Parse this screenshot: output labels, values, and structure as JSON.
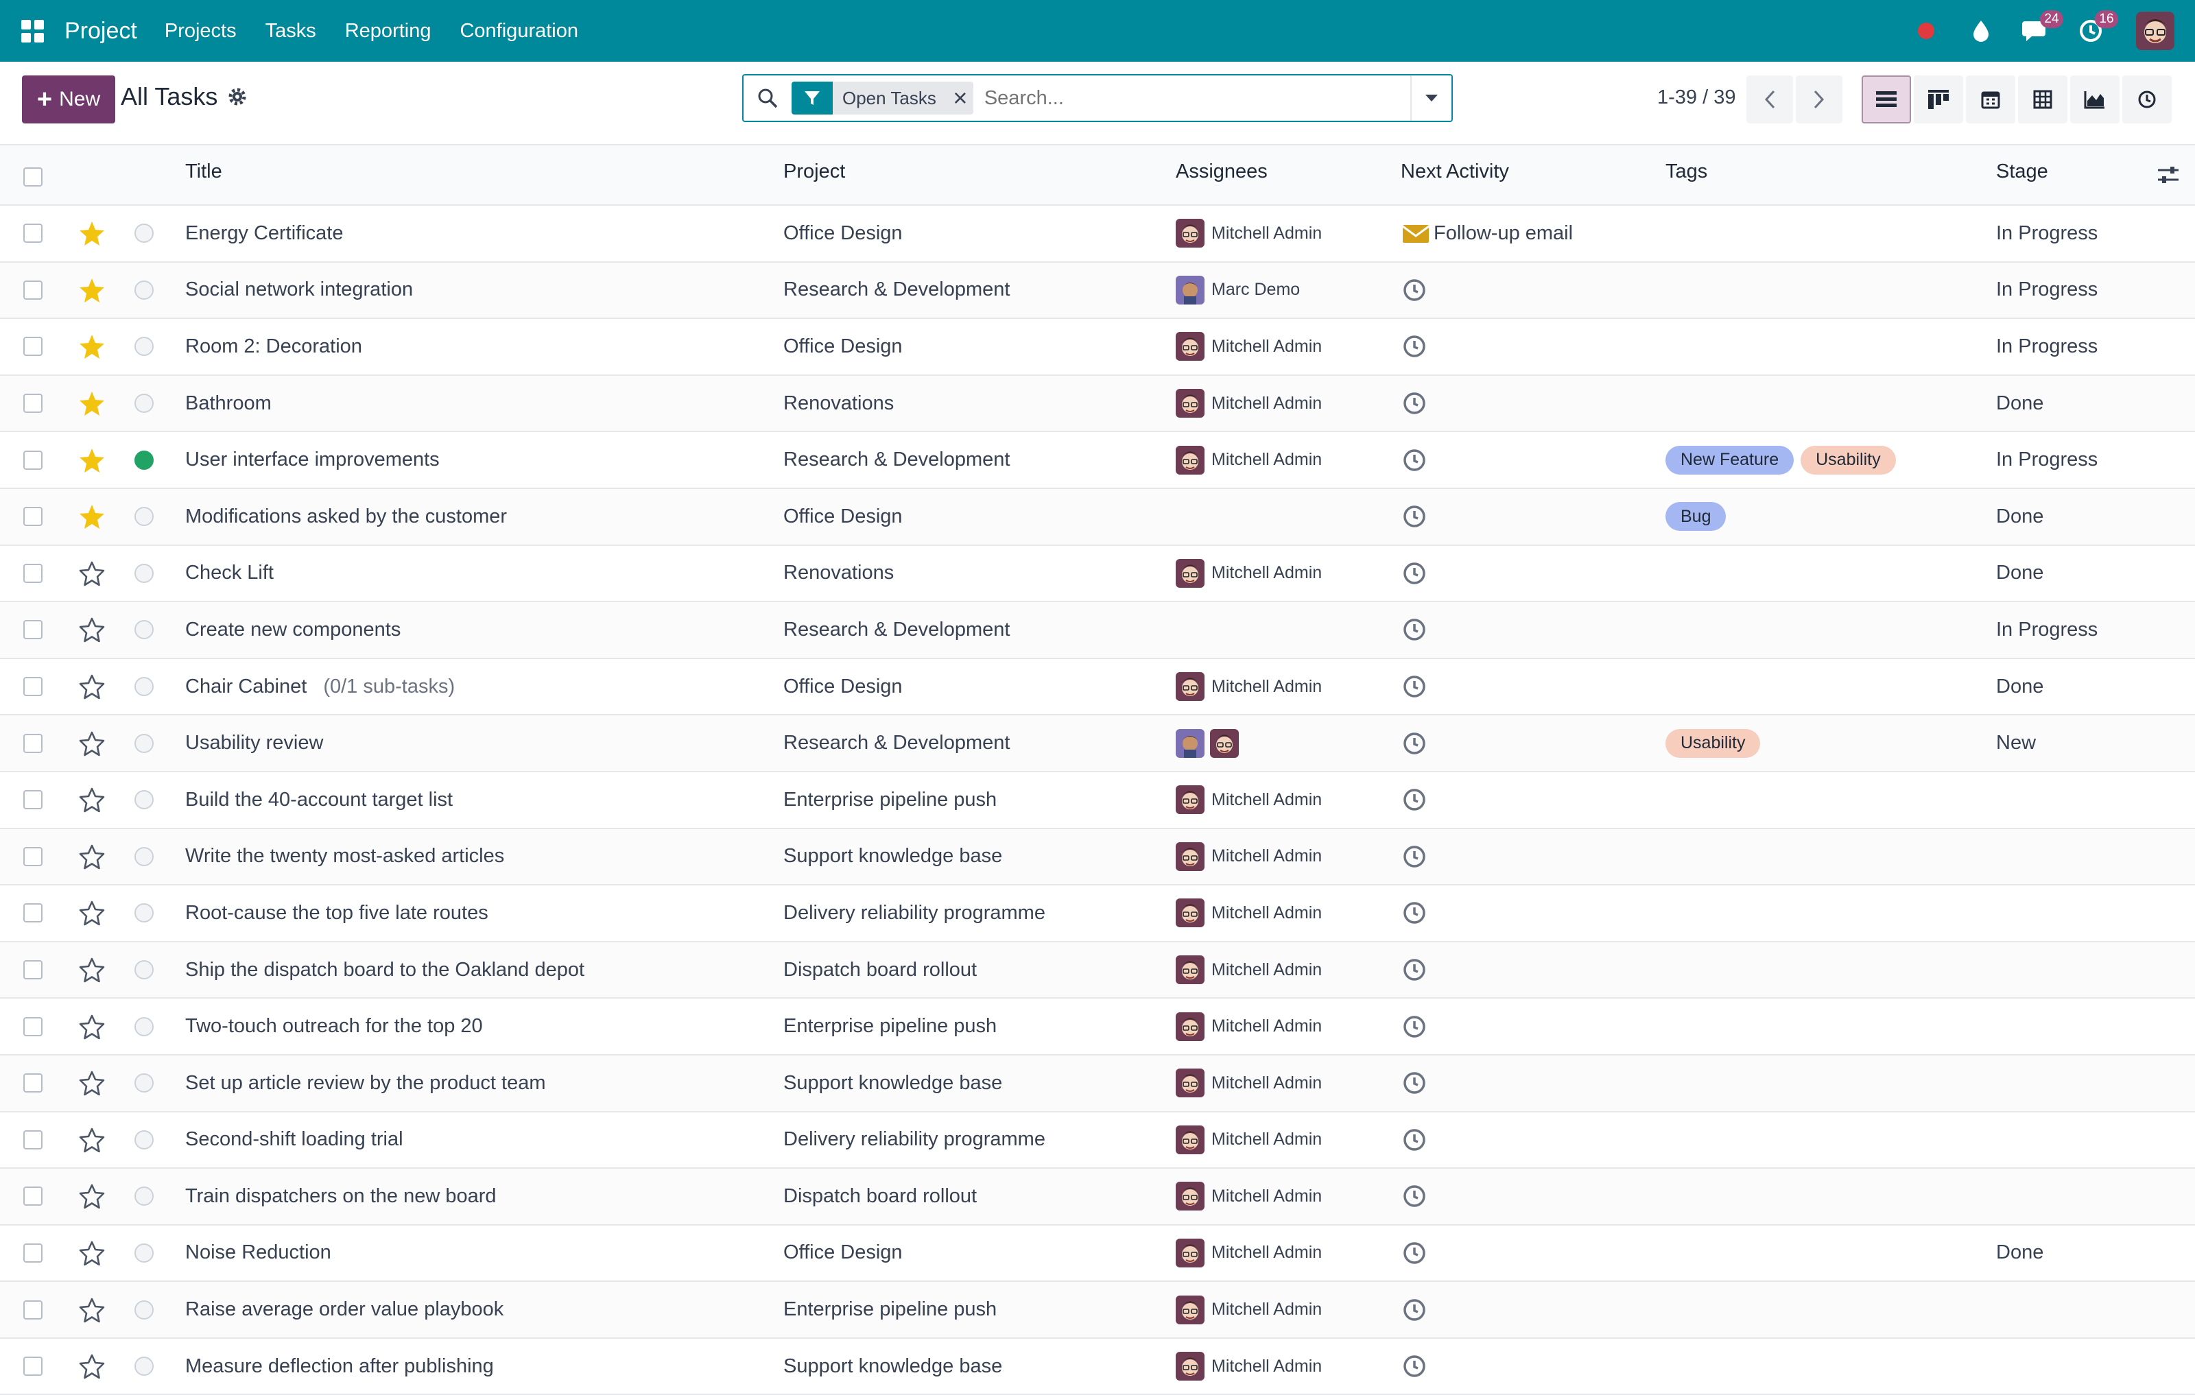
{
  "navbar": {
    "app_name": "Project",
    "menu": [
      "Projects",
      "Tasks",
      "Reporting",
      "Configuration"
    ],
    "messages_count": "24",
    "activities_count": "16",
    "color_brand": "#00889b",
    "icons": [
      "apps-grid-icon",
      "recording-dot-icon",
      "droplet-icon",
      "chat-icon",
      "clock-icon",
      "user-avatar"
    ]
  },
  "control_panel": {
    "new_label": "New",
    "breadcrumb": "All Tasks",
    "search": {
      "facet": "Open Tasks",
      "placeholder": "Search..."
    },
    "pager": "1-39 / 39",
    "views": [
      "list-view-icon",
      "kanban-view-icon",
      "calendar-view-icon",
      "pivot-view-icon",
      "graph-view-icon",
      "activity-view-icon"
    ],
    "active_view": "list"
  },
  "list": {
    "columns": [
      "Title",
      "Project",
      "Assignees",
      "Next Activity",
      "Tags",
      "Stage"
    ],
    "rows": [
      {
        "starred": true,
        "kanban_done": false,
        "title": "Energy Certificate",
        "subtasks": "",
        "project": "Office Design",
        "assignees": [
          {
            "name": "Mitchell Admin",
            "avatar": "mitchell"
          }
        ],
        "activity": "Follow-up email",
        "activity_icon": "envelope",
        "tags": [],
        "stage": "In Progress"
      },
      {
        "starred": true,
        "kanban_done": false,
        "title": "Social network integration",
        "subtasks": "",
        "project": "Research & Development",
        "assignees": [
          {
            "name": "Marc Demo",
            "avatar": "marc"
          }
        ],
        "activity": "",
        "activity_icon": "clock",
        "tags": [],
        "stage": "In Progress"
      },
      {
        "starred": true,
        "kanban_done": false,
        "title": "Room 2: Decoration",
        "subtasks": "",
        "project": "Office Design",
        "assignees": [
          {
            "name": "Mitchell Admin",
            "avatar": "mitchell"
          }
        ],
        "activity": "",
        "activity_icon": "clock",
        "tags": [],
        "stage": "In Progress"
      },
      {
        "starred": true,
        "kanban_done": false,
        "title": "Bathroom",
        "subtasks": "",
        "project": "Renovations",
        "assignees": [
          {
            "name": "Mitchell Admin",
            "avatar": "mitchell"
          }
        ],
        "activity": "",
        "activity_icon": "clock",
        "tags": [],
        "stage": "Done"
      },
      {
        "starred": true,
        "kanban_done": true,
        "title": "User interface improvements",
        "subtasks": "",
        "project": "Research & Development",
        "assignees": [
          {
            "name": "Mitchell Admin",
            "avatar": "mitchell"
          }
        ],
        "activity": "",
        "activity_icon": "clock",
        "tags": [
          {
            "label": "New Feature",
            "color": "blue"
          },
          {
            "label": "Usability",
            "color": "peach"
          }
        ],
        "stage": "In Progress"
      },
      {
        "starred": true,
        "kanban_done": false,
        "title": "Modifications asked by the customer",
        "subtasks": "",
        "project": "Office Design",
        "assignees": [],
        "activity": "",
        "activity_icon": "clock",
        "tags": [
          {
            "label": "Bug",
            "color": "blue"
          }
        ],
        "stage": "Done"
      },
      {
        "starred": false,
        "kanban_done": false,
        "title": "Check Lift",
        "subtasks": "",
        "project": "Renovations",
        "assignees": [
          {
            "name": "Mitchell Admin",
            "avatar": "mitchell"
          }
        ],
        "activity": "",
        "activity_icon": "clock",
        "tags": [],
        "stage": "Done"
      },
      {
        "starred": false,
        "kanban_done": false,
        "title": "Create new components",
        "subtasks": "",
        "project": "Research & Development",
        "assignees": [],
        "activity": "",
        "activity_icon": "clock",
        "tags": [],
        "stage": "In Progress"
      },
      {
        "starred": false,
        "kanban_done": false,
        "title": "Chair Cabinet",
        "subtasks": "(0/1 sub-tasks)",
        "project": "Office Design",
        "assignees": [
          {
            "name": "Mitchell Admin",
            "avatar": "mitchell"
          }
        ],
        "activity": "",
        "activity_icon": "clock",
        "tags": [],
        "stage": "Done"
      },
      {
        "starred": false,
        "kanban_done": false,
        "title": "Usability review",
        "subtasks": "",
        "project": "Research & Development",
        "assignees": [
          {
            "name": "",
            "avatar": "marc"
          },
          {
            "name": "",
            "avatar": "mitchell"
          }
        ],
        "activity": "",
        "activity_icon": "clock",
        "tags": [
          {
            "label": "Usability",
            "color": "peach"
          }
        ],
        "stage": "New"
      },
      {
        "starred": false,
        "kanban_done": false,
        "title": "Build the 40-account target list",
        "subtasks": "",
        "project": "Enterprise pipeline push",
        "assignees": [
          {
            "name": "Mitchell Admin",
            "avatar": "mitchell"
          }
        ],
        "activity": "",
        "activity_icon": "clock",
        "tags": [],
        "stage": ""
      },
      {
        "starred": false,
        "kanban_done": false,
        "title": "Write the twenty most-asked articles",
        "subtasks": "",
        "project": "Support knowledge base",
        "assignees": [
          {
            "name": "Mitchell Admin",
            "avatar": "mitchell"
          }
        ],
        "activity": "",
        "activity_icon": "clock",
        "tags": [],
        "stage": ""
      },
      {
        "starred": false,
        "kanban_done": false,
        "title": "Root-cause the top five late routes",
        "subtasks": "",
        "project": "Delivery reliability programme",
        "assignees": [
          {
            "name": "Mitchell Admin",
            "avatar": "mitchell"
          }
        ],
        "activity": "",
        "activity_icon": "clock",
        "tags": [],
        "stage": ""
      },
      {
        "starred": false,
        "kanban_done": false,
        "title": "Ship the dispatch board to the Oakland depot",
        "subtasks": "",
        "project": "Dispatch board rollout",
        "assignees": [
          {
            "name": "Mitchell Admin",
            "avatar": "mitchell"
          }
        ],
        "activity": "",
        "activity_icon": "clock",
        "tags": [],
        "stage": ""
      },
      {
        "starred": false,
        "kanban_done": false,
        "title": "Two-touch outreach for the top 20",
        "subtasks": "",
        "project": "Enterprise pipeline push",
        "assignees": [
          {
            "name": "Mitchell Admin",
            "avatar": "mitchell"
          }
        ],
        "activity": "",
        "activity_icon": "clock",
        "tags": [],
        "stage": ""
      },
      {
        "starred": false,
        "kanban_done": false,
        "title": "Set up article review by the product team",
        "subtasks": "",
        "project": "Support knowledge base",
        "assignees": [
          {
            "name": "Mitchell Admin",
            "avatar": "mitchell"
          }
        ],
        "activity": "",
        "activity_icon": "clock",
        "tags": [],
        "stage": ""
      },
      {
        "starred": false,
        "kanban_done": false,
        "title": "Second-shift loading trial",
        "subtasks": "",
        "project": "Delivery reliability programme",
        "assignees": [
          {
            "name": "Mitchell Admin",
            "avatar": "mitchell"
          }
        ],
        "activity": "",
        "activity_icon": "clock",
        "tags": [],
        "stage": ""
      },
      {
        "starred": false,
        "kanban_done": false,
        "title": "Train dispatchers on the new board",
        "subtasks": "",
        "project": "Dispatch board rollout",
        "assignees": [
          {
            "name": "Mitchell Admin",
            "avatar": "mitchell"
          }
        ],
        "activity": "",
        "activity_icon": "clock",
        "tags": [],
        "stage": ""
      },
      {
        "starred": false,
        "kanban_done": false,
        "title": "Noise Reduction",
        "subtasks": "",
        "project": "Office Design",
        "assignees": [
          {
            "name": "Mitchell Admin",
            "avatar": "mitchell"
          }
        ],
        "activity": "",
        "activity_icon": "clock",
        "tags": [],
        "stage": "Done"
      },
      {
        "starred": false,
        "kanban_done": false,
        "title": "Raise average order value playbook",
        "subtasks": "",
        "project": "Enterprise pipeline push",
        "assignees": [
          {
            "name": "Mitchell Admin",
            "avatar": "mitchell"
          }
        ],
        "activity": "",
        "activity_icon": "clock",
        "tags": [],
        "stage": ""
      },
      {
        "starred": false,
        "kanban_done": false,
        "title": "Measure deflection after publishing",
        "subtasks": "",
        "project": "Support knowledge base",
        "assignees": [
          {
            "name": "Mitchell Admin",
            "avatar": "mitchell"
          }
        ],
        "activity": "",
        "activity_icon": "clock",
        "tags": [],
        "stage": ""
      }
    ]
  },
  "colors": {
    "star": "#f3c40f",
    "tag_blue": "#a5b7f2",
    "tag_peach": "#f7cdbd",
    "new_button": "#71396b",
    "kanban_done": "#21a366"
  }
}
